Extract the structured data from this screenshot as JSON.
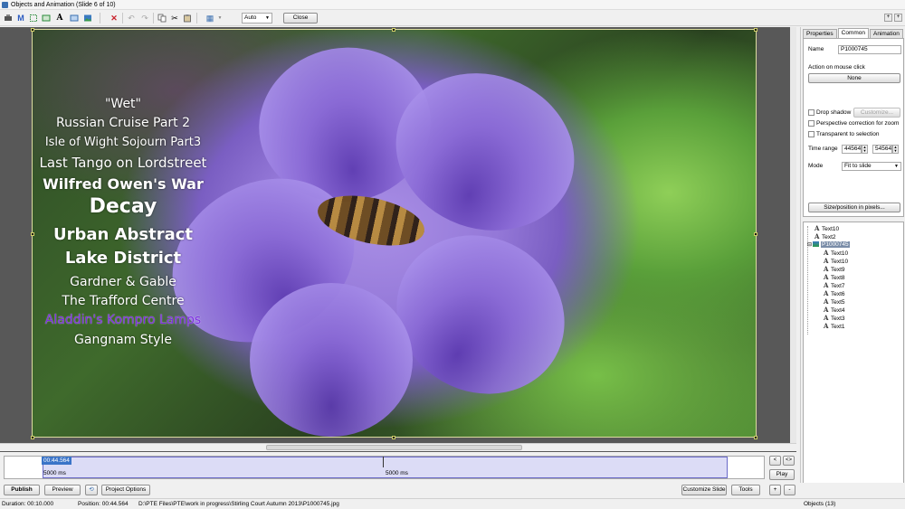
{
  "window": {
    "title": "Objects and Animation  (Slide 6 of 10)"
  },
  "toolbar": {
    "zoom_value": "Auto",
    "close_label": "Close",
    "icons": [
      "add-object-icon",
      "text-m-icon",
      "rectangle-frame-icon",
      "frame-icon",
      "text-a-icon",
      "image-icon",
      "button-icon",
      "delete-icon",
      "undo-icon",
      "redo-icon",
      "copy-icon",
      "cut-icon",
      "paste-icon",
      "grid-icon"
    ]
  },
  "slide": {
    "texts": [
      {
        "text": "\"Wet\"",
        "size": "small"
      },
      {
        "text": "Russian Cruise Part 2",
        "size": "small"
      },
      {
        "text": "Isle of Wight Sojourn Part3",
        "size": "small"
      },
      {
        "text": "Last Tango on Lordstreet",
        "size": "medium"
      },
      {
        "text": "Wilfred Owen's War",
        "size": "medium"
      },
      {
        "text": "Decay",
        "size": "large"
      },
      {
        "text": "Urban Abstract",
        "size": "medium"
      },
      {
        "text": "Lake District",
        "size": "medium"
      },
      {
        "text": "Gardner & Gable",
        "size": "small"
      },
      {
        "text": "The Trafford Centre",
        "size": "small"
      },
      {
        "text": "Aladdin's Kompro Lamps",
        "size": "small",
        "highlighted": true
      },
      {
        "text": "Gangnam Style",
        "size": "small"
      }
    ]
  },
  "panel": {
    "tabs": [
      "Properties",
      "Common",
      "Animation"
    ],
    "active_tab": "Common",
    "name_label": "Name",
    "name_value": "P1000745",
    "action_label": "Action on mouse click",
    "action_value": "None",
    "drop_shadow_label": "Drop shadow",
    "customize_label": "Customize...",
    "perspective_label": "Perspective correction for zoom",
    "transparent_label": "Transparent to selection",
    "time_range_label": "Time range",
    "time_start": "44564",
    "time_end": "54564",
    "mode_label": "Mode",
    "mode_value": "Fit to slide",
    "size_position_label": "Size/position in pixels..."
  },
  "tree": {
    "items": [
      {
        "label": "Text10",
        "level": 0
      },
      {
        "label": "Text2",
        "level": 0
      },
      {
        "label": "P1000745",
        "level": 0,
        "selected": true,
        "kind": "image"
      },
      {
        "label": "Text10",
        "level": 1
      },
      {
        "label": "Text10",
        "level": 1
      },
      {
        "label": "Text9",
        "level": 1
      },
      {
        "label": "Text8",
        "level": 1
      },
      {
        "label": "Text7",
        "level": 1
      },
      {
        "label": "Text6",
        "level": 1
      },
      {
        "label": "Text5",
        "level": 1
      },
      {
        "label": "Text4",
        "level": 1
      },
      {
        "label": "Text3",
        "level": 1
      },
      {
        "label": "Text1",
        "level": 1
      }
    ]
  },
  "timeline": {
    "current_time": "00:44.564",
    "duration_left": "5000 ms",
    "duration_right": "5000 ms",
    "prev_label": "<",
    "next_label": "<>",
    "play_label": "Play"
  },
  "bottom": {
    "publish": "Publish",
    "preview": "Preview",
    "project_options": "Project Options",
    "customize_slide": "Customize Slide",
    "tools": "Tools",
    "plus": "+",
    "minus": "-"
  },
  "status": {
    "duration": "Duration:  00:10.000",
    "position": "Position:  00:44.564",
    "path": "D:\\PTE Files\\PTE\\work in progress\\Stirling Court Autumn 2013\\P1000745.jpg",
    "objects": "Objects (13)"
  }
}
